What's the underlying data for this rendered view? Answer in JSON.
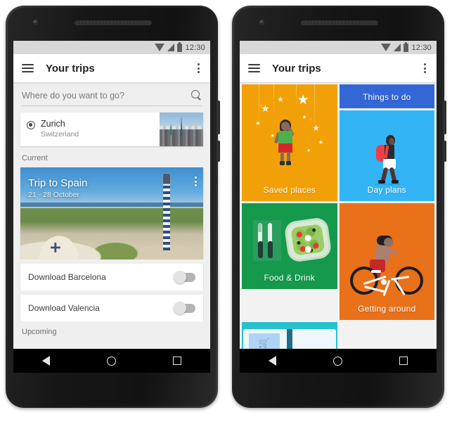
{
  "phones": [
    {
      "name": "left-phone",
      "statusbar": {
        "time": "12:30",
        "icons": [
          "wifi-icon",
          "signal-icon",
          "battery-icon"
        ]
      },
      "appbar": {
        "title": "Your trips",
        "menu_icon": "hamburger-menu-icon",
        "overflow_icon": "overflow-menu-icon"
      },
      "search": {
        "placeholder": "Where do you want to go?",
        "value": "",
        "icon": "search-icon"
      },
      "place_card": {
        "city": "Zurich",
        "country": "Switzerland",
        "pin_icon": "location-pin-icon"
      },
      "sections": {
        "current": "Current",
        "upcoming": "Upcoming"
      },
      "trip": {
        "title": "Trip to Spain",
        "dates": "21 - 28 October",
        "overflow_icon": "overflow-menu-icon"
      },
      "downloads": [
        {
          "label": "Download Barcelona",
          "on": false
        },
        {
          "label": "Download Valencia",
          "on": false
        }
      ],
      "navbar": {
        "back": "back-button",
        "home": "home-button",
        "recents": "recents-button"
      }
    },
    {
      "name": "right-phone",
      "statusbar": {
        "time": "12:30",
        "icons": [
          "wifi-icon",
          "signal-icon",
          "battery-icon"
        ]
      },
      "appbar": {
        "title": "Your trips",
        "menu_icon": "hamburger-menu-icon",
        "overflow_icon": "overflow-menu-icon"
      },
      "tiles": [
        {
          "label": "Saved places",
          "color": "#F2A007",
          "illustration": "girl-reaching-stars"
        },
        {
          "label": "Things to do",
          "color": "#3367D6",
          "illustration": "none"
        },
        {
          "label": "Day plans",
          "color": "#33B5F5",
          "illustration": "walking-backpacker"
        },
        {
          "label": "Food & Drink",
          "color": "#15994C",
          "illustration": "salad-fork-knife"
        },
        {
          "label": "Getting around",
          "color": "#E8711A",
          "illustration": "cyclist"
        },
        {
          "label": "",
          "color": "#26C0CE",
          "illustration": "open-book-guide"
        }
      ],
      "navbar": {
        "back": "back-button",
        "home": "home-button",
        "recents": "recents-button"
      }
    }
  ],
  "colors": {
    "saved_places": "#F2A007",
    "things_to_do": "#3367D6",
    "day_plans": "#33B5F5",
    "food_drink": "#15994C",
    "getting_around": "#E8711A",
    "book_tile": "#26C0CE",
    "statusbar": "#D8D8D8",
    "screen_bg": "#EFEFEF"
  }
}
